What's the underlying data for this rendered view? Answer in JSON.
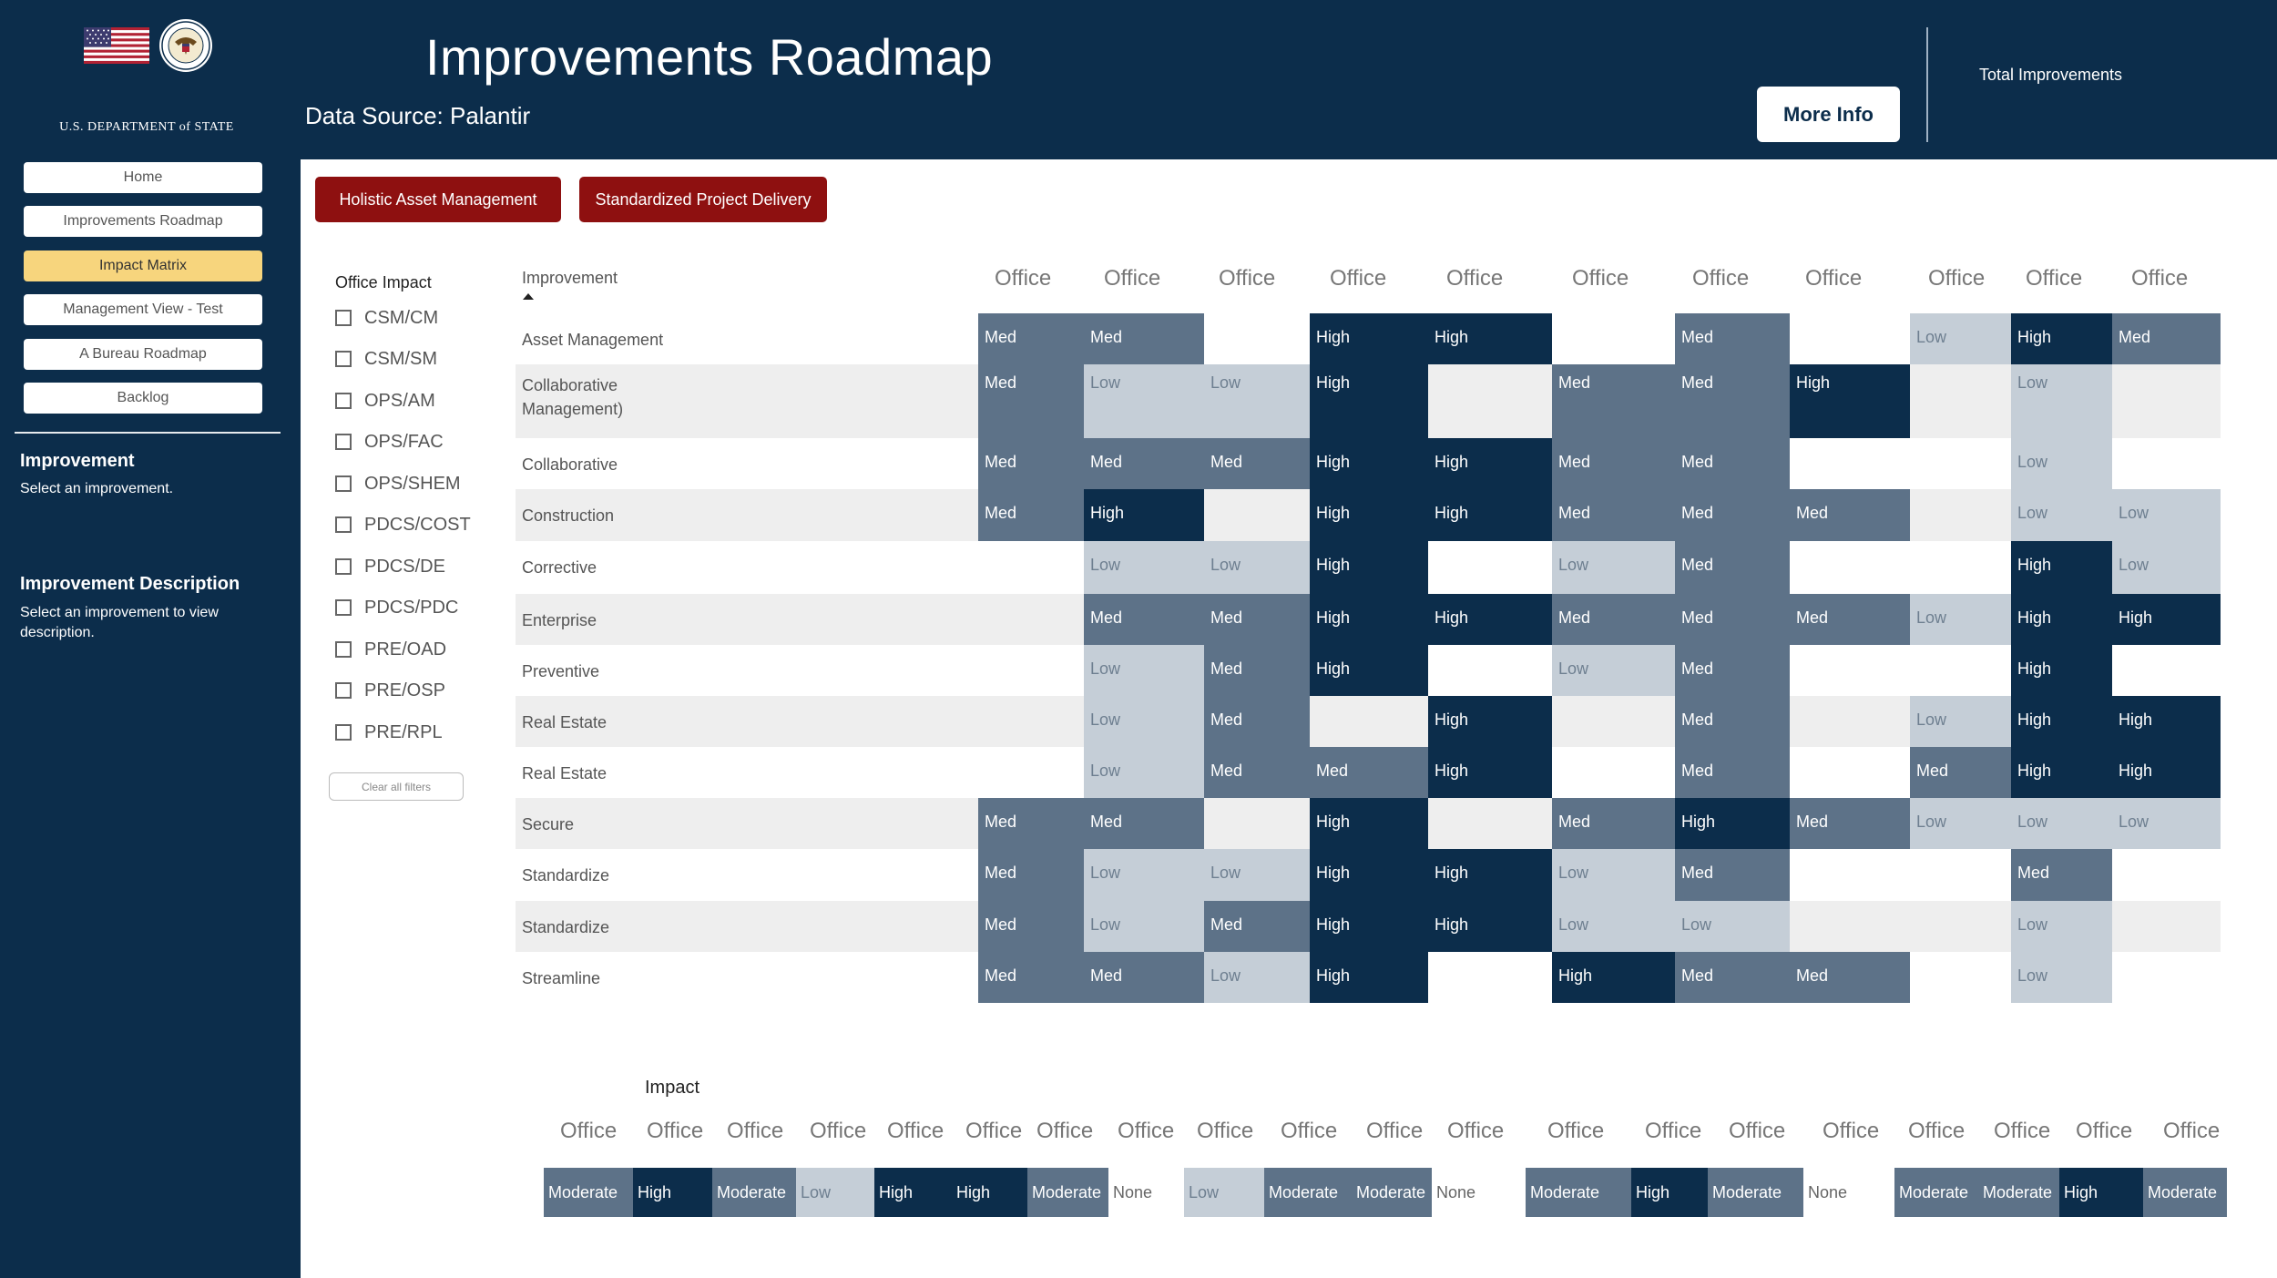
{
  "sidebar": {
    "department": "U.S. DEPARTMENT of STATE",
    "nav": [
      "Home",
      "Improvements Roadmap",
      "Impact Matrix",
      "Management View - Test",
      "A Bureau Roadmap",
      "Backlog"
    ],
    "active_nav": "Impact Matrix",
    "improvement_heading": "Improvement",
    "improvement_text": "Select an improvement.",
    "description_heading": "Improvement Description",
    "description_text": "Select an improvement to view description."
  },
  "header": {
    "title": "Improvements Roadmap",
    "data_source": "Data Source: Palantir",
    "more_info": "More Info",
    "total_label": "Total Improvements"
  },
  "tabs": [
    "Holistic Asset Management",
    "Standardized Project Delivery"
  ],
  "filter": {
    "title": "Office Impact",
    "options": [
      "CSM/CM",
      "CSM/SM",
      "OPS/AM",
      "OPS/FAC",
      "OPS/SHEM",
      "PDCS/COST",
      "PDCS/DE",
      "PDCS/PDC",
      "PRE/OAD",
      "PRE/OSP",
      "PRE/RPL"
    ],
    "clear": "Clear all filters"
  },
  "matrix": {
    "row_header": "Improvement",
    "columns": [
      "Office",
      "Office",
      "Office",
      "Office",
      "Office",
      "Office",
      "Office",
      "Office",
      "Office",
      "Office",
      "Office"
    ],
    "rows": [
      {
        "label": "Asset Management",
        "cells": [
          "Med",
          "Med",
          "",
          "High",
          "High",
          "",
          "Med",
          "",
          "Low",
          "High",
          "Med"
        ]
      },
      {
        "label": "Collaborative Management)",
        "cells": [
          "Med",
          "Low",
          "Low",
          "High",
          "",
          "Med",
          "Med",
          "High",
          "",
          "Low",
          ""
        ]
      },
      {
        "label": "Collaborative",
        "cells": [
          "Med",
          "Med",
          "Med",
          "High",
          "High",
          "Med",
          "Med",
          "",
          "",
          "Low",
          ""
        ]
      },
      {
        "label": "Construction",
        "cells": [
          "Med",
          "High",
          "",
          "High",
          "High",
          "Med",
          "Med",
          "Med",
          "",
          "Low",
          "Low"
        ]
      },
      {
        "label": "Corrective",
        "cells": [
          "",
          "Low",
          "Low",
          "High",
          "",
          "Low",
          "Med",
          "",
          "",
          "High",
          "Low"
        ]
      },
      {
        "label": "Enterprise",
        "cells": [
          "",
          "Med",
          "Med",
          "High",
          "High",
          "Med",
          "Med",
          "Med",
          "Low",
          "High",
          "High"
        ]
      },
      {
        "label": "Preventive",
        "cells": [
          "",
          "Low",
          "Med",
          "High",
          "",
          "Low",
          "Med",
          "",
          "",
          "High",
          ""
        ]
      },
      {
        "label": "Real Estate",
        "cells": [
          "",
          "Low",
          "Med",
          "",
          "High",
          "",
          "Med",
          "",
          "Low",
          "High",
          "High"
        ]
      },
      {
        "label": "Real Estate",
        "cells": [
          "",
          "Low",
          "Med",
          "Med",
          "High",
          "",
          "Med",
          "",
          "Med",
          "High",
          "High"
        ]
      },
      {
        "label": "Secure",
        "cells": [
          "Med",
          "Med",
          "",
          "High",
          "",
          "Med",
          "High",
          "Med",
          "Low",
          "Low",
          "Low"
        ]
      },
      {
        "label": "Standardize",
        "cells": [
          "Med",
          "Low",
          "Low",
          "High",
          "High",
          "Low",
          "Med",
          "",
          "",
          "Med",
          ""
        ]
      },
      {
        "label": "Standardize",
        "cells": [
          "Med",
          "Low",
          "Med",
          "High",
          "High",
          "Low",
          "Low",
          "",
          "",
          "Low",
          ""
        ]
      },
      {
        "label": "Streamline",
        "cells": [
          "Med",
          "Med",
          "Low",
          "High",
          "",
          "High",
          "Med",
          "Med",
          "",
          "Low",
          ""
        ]
      }
    ]
  },
  "impact": {
    "title": "Impact",
    "columns": [
      {
        "label": "Office",
        "value": "Moderate"
      },
      {
        "label": "Office",
        "value": "High"
      },
      {
        "label": "Office",
        "value": "Moderate"
      },
      {
        "label": "Office",
        "value": "Low"
      },
      {
        "label": "Office",
        "value": "High"
      },
      {
        "label": "Office",
        "value": "High"
      },
      {
        "label": "Office",
        "value": "Moderate"
      },
      {
        "label": "Office",
        "value": "None"
      },
      {
        "label": "Office",
        "value": "Low"
      },
      {
        "label": "Office",
        "value": "Moderate"
      },
      {
        "label": "Office",
        "value": "Moderate"
      },
      {
        "label": "Office",
        "value": "None"
      },
      {
        "label": "Office",
        "value": "Moderate"
      },
      {
        "label": "Office",
        "value": "High"
      },
      {
        "label": "Office",
        "value": "Moderate"
      },
      {
        "label": "Office",
        "value": "None"
      },
      {
        "label": "Office",
        "value": "Moderate"
      },
      {
        "label": "Office",
        "value": "Moderate"
      },
      {
        "label": "Office",
        "value": "High"
      },
      {
        "label": "Office",
        "value": "Moderate"
      }
    ]
  },
  "colors": {
    "navy": "#0c2d4b",
    "high": "#0c2d4b",
    "med": "#5d7288",
    "low": "#c5ced7",
    "active_nav": "#f7d57d",
    "tab_red": "#8e1010"
  }
}
